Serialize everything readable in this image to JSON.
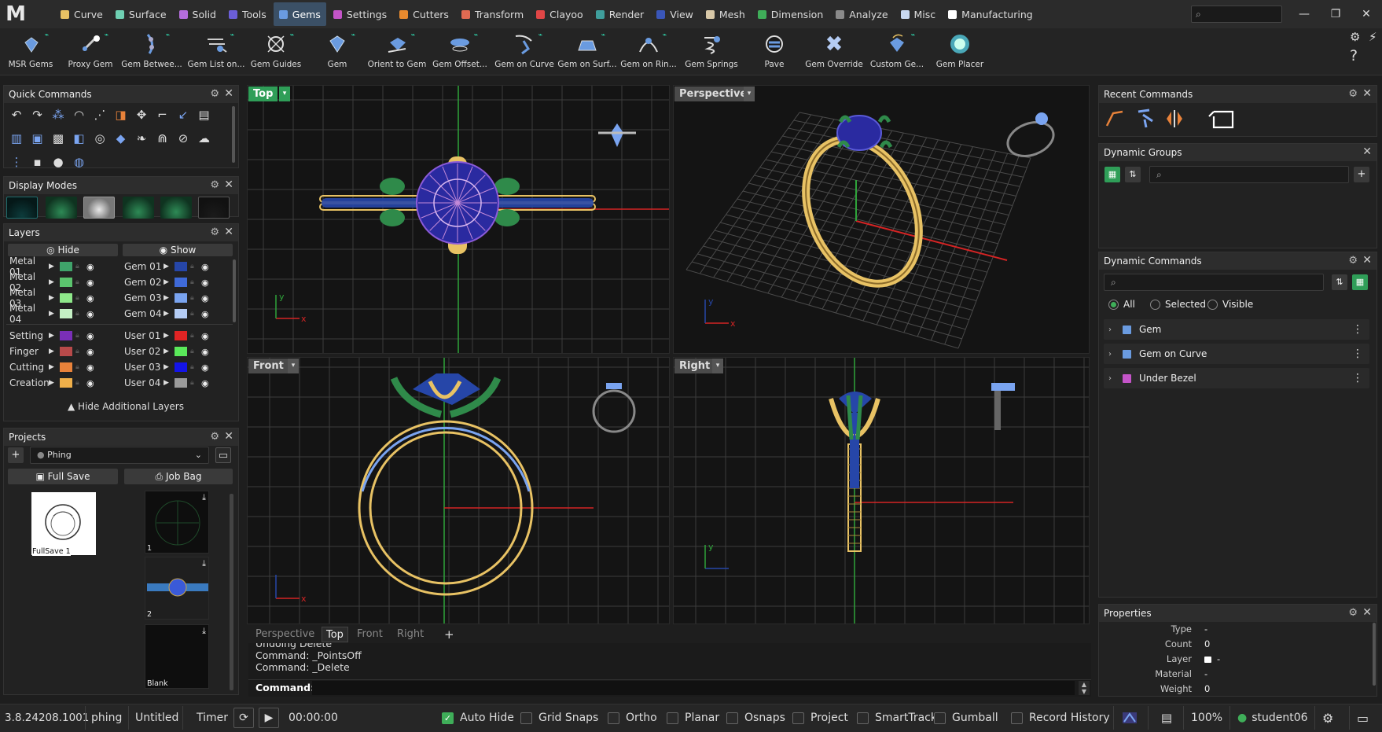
{
  "app": {
    "logo": "M",
    "version": "3.8.24208.1001"
  },
  "menu": [
    {
      "label": "Curve",
      "color": "#e8c264"
    },
    {
      "label": "Surface",
      "color": "#6fd0b3"
    },
    {
      "label": "Solid",
      "color": "#b46ddc"
    },
    {
      "label": "Tools",
      "color": "#6b5ed8"
    },
    {
      "label": "Gems",
      "color": "#6a9be0",
      "active": true
    },
    {
      "label": "Settings",
      "color": "#c454c8"
    },
    {
      "label": "Cutters",
      "color": "#e88a2e"
    },
    {
      "label": "Transform",
      "color": "#e06a52"
    },
    {
      "label": "Clayoo",
      "color": "#e04646"
    },
    {
      "label": "Render",
      "color": "#3f9e9c"
    },
    {
      "label": "View",
      "color": "#3a56b8"
    },
    {
      "label": "Mesh",
      "color": "#d8c8a8"
    },
    {
      "label": "Dimension",
      "color": "#3fae59"
    },
    {
      "label": "Analyze",
      "color": "#8a8a8a"
    },
    {
      "label": "Misc",
      "color": "#c8d8f0"
    },
    {
      "label": "Manufacturing",
      "color": "#ffffff"
    }
  ],
  "menu_search": {
    "placeholder": ""
  },
  "window": {
    "minimize": "—",
    "restore": "❐",
    "close": "✕"
  },
  "toolbar": [
    "MSR Gems",
    "Proxy Gem",
    "Gem Betwee...",
    "Gem List on...",
    "Gem Guides",
    "Gem",
    "Orient to Gem",
    "Gem Offset...",
    "Gem on Curve",
    "Gem on Surf...",
    "Gem on Rin...",
    "Gem Springs",
    "Pave",
    "Gem Override",
    "Custom Ge...",
    "Gem Placer"
  ],
  "toolbar_right": {
    "settings": "⚙",
    "pin": "⚡",
    "help": "?"
  },
  "quick_commands": {
    "title": "Quick Commands"
  },
  "display_modes": {
    "title": "Display Modes"
  },
  "layers": {
    "title": "Layers",
    "hide": "Hide",
    "show": "Show",
    "left": [
      {
        "name": "Metal 01",
        "color": "#3fa36a"
      },
      {
        "name": "Metal 02",
        "color": "#5bc46e"
      },
      {
        "name": "Metal 03",
        "color": "#8ee88a"
      },
      {
        "name": "Metal 04",
        "color": "#c4f0c4"
      },
      {
        "name": "Setting",
        "color": "#7a2fb8"
      },
      {
        "name": "Finger",
        "color": "#b84a4a"
      },
      {
        "name": "Cutting",
        "color": "#e8823a"
      },
      {
        "name": "Creation",
        "color": "#f0b04a"
      }
    ],
    "right": [
      {
        "name": "Gem 01",
        "color": "#2646a8"
      },
      {
        "name": "Gem 02",
        "color": "#3f6ad8"
      },
      {
        "name": "Gem 03",
        "color": "#7aa4f0"
      },
      {
        "name": "Gem 04",
        "color": "#b4ccf4"
      },
      {
        "name": "User 01",
        "color": "#e02424"
      },
      {
        "name": "User 02",
        "color": "#5ae85a"
      },
      {
        "name": "User 03",
        "color": "#1414e8"
      },
      {
        "name": "User 04",
        "color": "#9a9a9a"
      }
    ],
    "hide_additional": "Hide Additional Layers"
  },
  "projects": {
    "title": "Projects",
    "current": "Phing",
    "full_save": "Full Save",
    "job_bag": "Job Bag",
    "thumbs": [
      {
        "label": "FullSave 1"
      },
      {
        "label": "1"
      },
      {
        "label": "2"
      },
      {
        "label": "Blank"
      }
    ]
  },
  "viewports": {
    "top": "Top",
    "perspective": "Perspective",
    "front": "Front",
    "right": "Right"
  },
  "view_tabs": [
    "Perspective",
    "Top",
    "Front",
    "Right"
  ],
  "view_tab_add": "+",
  "command": {
    "history": [
      "Undoing Delete",
      "Command: _PointsOff",
      "Command: _Delete"
    ],
    "prompt": "Command:",
    "value": ""
  },
  "recent_commands": {
    "title": "Recent Commands"
  },
  "dynamic_groups": {
    "title": "Dynamic Groups",
    "search_placeholder": ""
  },
  "dynamic_commands": {
    "title": "Dynamic Commands",
    "search_placeholder": "",
    "filters": [
      {
        "label": "All",
        "selected": true
      },
      {
        "label": "Selected",
        "selected": false
      },
      {
        "label": "Visible",
        "selected": false
      }
    ],
    "items": [
      {
        "label": "Gem",
        "color": "#6a9be0"
      },
      {
        "label": "Gem on Curve",
        "color": "#6a9be0"
      },
      {
        "label": "Under Bezel",
        "color": "#c454c8"
      }
    ]
  },
  "properties": {
    "title": "Properties",
    "rows": [
      {
        "key": "Type",
        "value": "-"
      },
      {
        "key": "Count",
        "value": "0"
      },
      {
        "key": "Layer",
        "value": "-"
      },
      {
        "key": "Material",
        "value": "-"
      },
      {
        "key": "Weight",
        "value": "0"
      }
    ]
  },
  "status": {
    "user_tag": "phing",
    "doc": "Untitled",
    "timer_label": "Timer",
    "timer": "00:00:00",
    "toggles": [
      {
        "label": "Auto Hide",
        "on": true
      },
      {
        "label": "Grid Snaps",
        "on": false
      },
      {
        "label": "Ortho",
        "on": false
      },
      {
        "label": "Planar",
        "on": false
      },
      {
        "label": "Osnaps",
        "on": false
      },
      {
        "label": "Project",
        "on": false
      },
      {
        "label": "SmartTrack",
        "on": false
      },
      {
        "label": "Gumball",
        "on": false
      },
      {
        "label": "Record History",
        "on": false
      }
    ],
    "zoom": "100%",
    "user": "student06"
  },
  "axis": {
    "x": "x",
    "y": "y"
  }
}
